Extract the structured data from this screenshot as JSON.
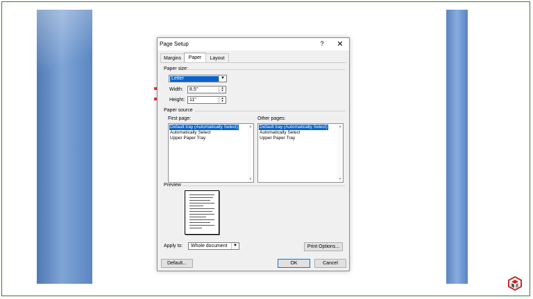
{
  "dialog": {
    "title": "Page Setup",
    "help_label": "?",
    "close_label": "✕",
    "tabs": [
      {
        "label": "Margins"
      },
      {
        "label": "Paper"
      },
      {
        "label": "Layout"
      }
    ],
    "paper_size": {
      "section_label": "Paper size:",
      "selected": "Letter",
      "width_label": "Width:",
      "width_value": "8.5\"",
      "height_label": "Height:",
      "height_value": "11\""
    },
    "paper_source": {
      "section_label": "Paper source",
      "first_page_label": "First page:",
      "other_pages_label": "Other pages:",
      "first_page_items": [
        "Default tray (Automatically Select)",
        "Automatically Select",
        "Upper Paper Tray"
      ],
      "other_pages_items": [
        "Default tray (Automatically Select)",
        "Automatically Select",
        "Upper Paper Tray"
      ]
    },
    "preview": {
      "section_label": "Preview",
      "apply_to_label": "Apply to:",
      "apply_to_value": "Whole document"
    },
    "buttons": {
      "print_options": "Print Options...",
      "default": "Default...",
      "ok": "OK",
      "cancel": "Cancel"
    }
  },
  "colors": {
    "accent": "#0a64c8",
    "annotation_arrow": "#e53935",
    "side_panel": "#6a92cc"
  }
}
